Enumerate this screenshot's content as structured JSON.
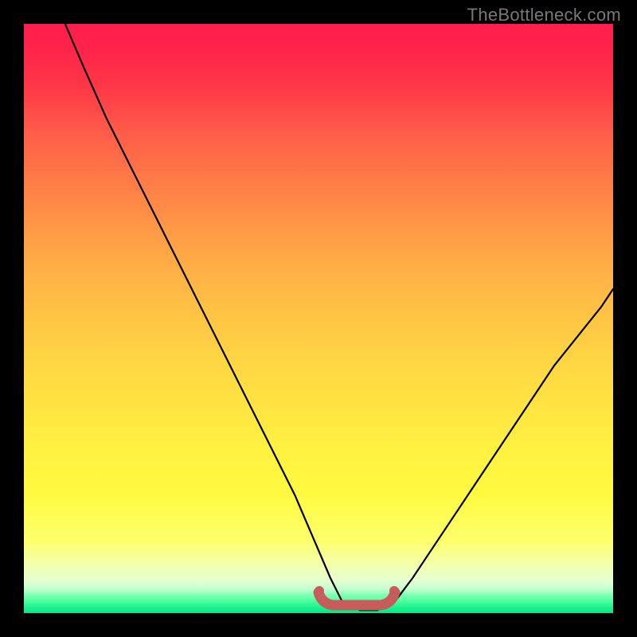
{
  "watermark": {
    "text": "TheBottleneck.com"
  },
  "colors": {
    "page_bg": "#000000",
    "curve": "#000000",
    "optimal_band": "#c75c5c",
    "gradient_top": "#ff1e4d",
    "gradient_mid": "#ffd743",
    "gradient_bottom": "#00e883"
  },
  "chart_data": {
    "type": "line",
    "title": "",
    "xlabel": "",
    "ylabel": "",
    "xlim": [
      0,
      100
    ],
    "ylim": [
      0,
      100
    ],
    "note": "Axis values are estimated from pixel positions since no tick labels are printed. x is normalised left→right 0–100; y is bottleneck percentage 0 (bottom, green, ideal) to 100 (top, red, severe).",
    "series": [
      {
        "name": "bottleneck-curve",
        "color": "#000000",
        "x": [
          7,
          10,
          14,
          18,
          22,
          26,
          30,
          34,
          38,
          42,
          46,
          49,
          52,
          54,
          57,
          60,
          63,
          66,
          70,
          74,
          78,
          82,
          86,
          90,
          94,
          98,
          100
        ],
        "y": [
          100,
          93,
          84,
          76,
          68,
          60,
          52,
          44,
          36,
          28,
          20,
          13,
          6,
          2,
          0.5,
          0.5,
          2,
          6,
          12,
          18,
          24,
          30,
          36,
          42,
          47,
          52,
          55
        ]
      }
    ],
    "optimal_band": {
      "name": "optimal-range",
      "color": "#c75c5c",
      "x_range": [
        50,
        62
      ],
      "y": 1.5
    }
  }
}
